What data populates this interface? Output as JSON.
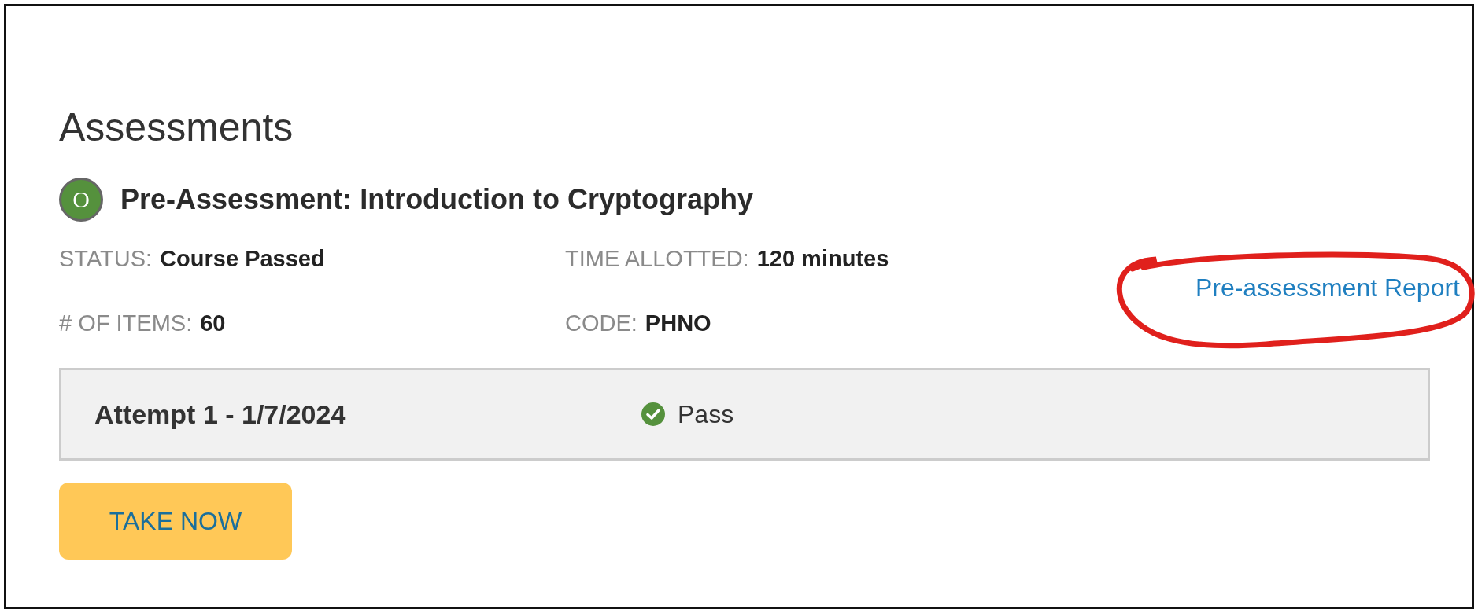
{
  "section_title": "Assessments",
  "assessment": {
    "badge": "O",
    "title": "Pre-Assessment: Introduction to Cryptography",
    "details": [
      {
        "label": "STATUS:",
        "value": "Course Passed"
      },
      {
        "label": "TIME ALLOTTED:",
        "value": "120 minutes"
      },
      {
        "label": "# OF ITEMS:",
        "value": "60"
      },
      {
        "label": "CODE:",
        "value": "PHNO"
      }
    ],
    "report_link": {
      "label": "Pre-assessment Report",
      "circled": true
    },
    "attempts": [
      {
        "label": "Attempt 1 - 1/7/2024",
        "result": "Pass",
        "passed": true
      }
    ],
    "action_button": "TAKE NOW"
  }
}
